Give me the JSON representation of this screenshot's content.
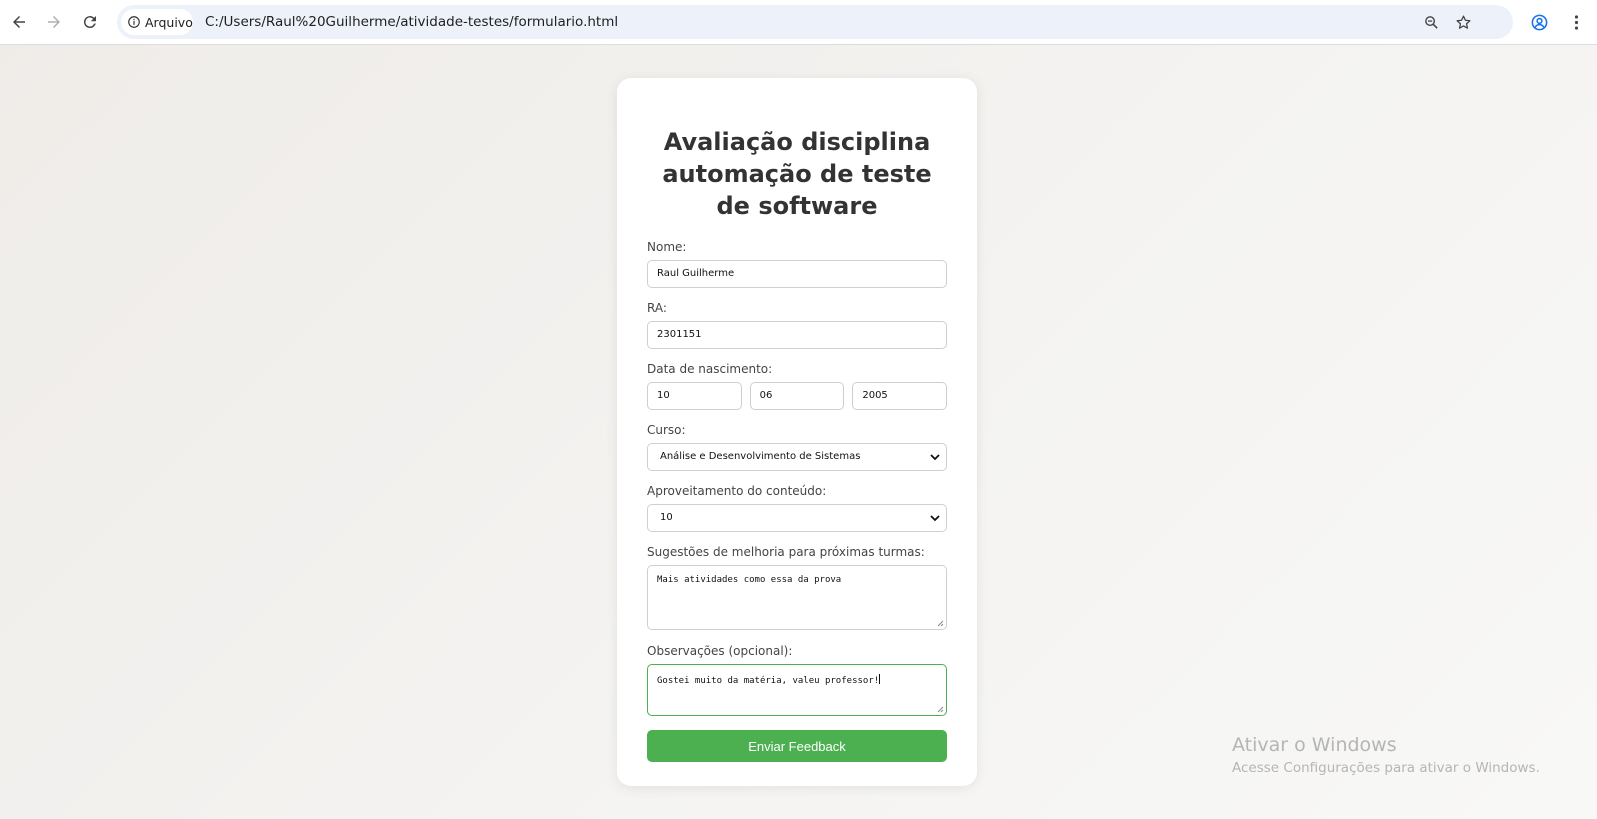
{
  "browser": {
    "security_chip": "Arquivo",
    "url": "C:/Users/Raul%20Guilherme/atividade-testes/formulario.html"
  },
  "form": {
    "title": "Avaliação disciplina automação de teste de software",
    "name_label": "Nome:",
    "name_value": "Raul Guilherme",
    "ra_label": "RA:",
    "ra_value": "2301151",
    "birth_label": "Data de nascimento:",
    "birth_day": "10",
    "birth_month": "06",
    "birth_year": "2005",
    "course_label": "Curso:",
    "course_value": "Análise e Desenvolvimento de Sistemas",
    "rating_label": "Aproveitamento do conteúdo:",
    "rating_value": "10",
    "suggestions_label": "Sugestões de melhoria para próximas turmas:",
    "suggestions_value": "Mais atividades como essa da prova",
    "notes_label": "Observações (opcional):",
    "notes_value": "Gostei muito da matéria, valeu professor!",
    "submit_label": "Enviar Feedback"
  },
  "watermark": {
    "title": "Ativar o Windows",
    "subtitle": "Acesse Configurações para ativar o Windows."
  },
  "colors": {
    "accent": "#4caf50",
    "omnibox": "#edf2fa"
  }
}
